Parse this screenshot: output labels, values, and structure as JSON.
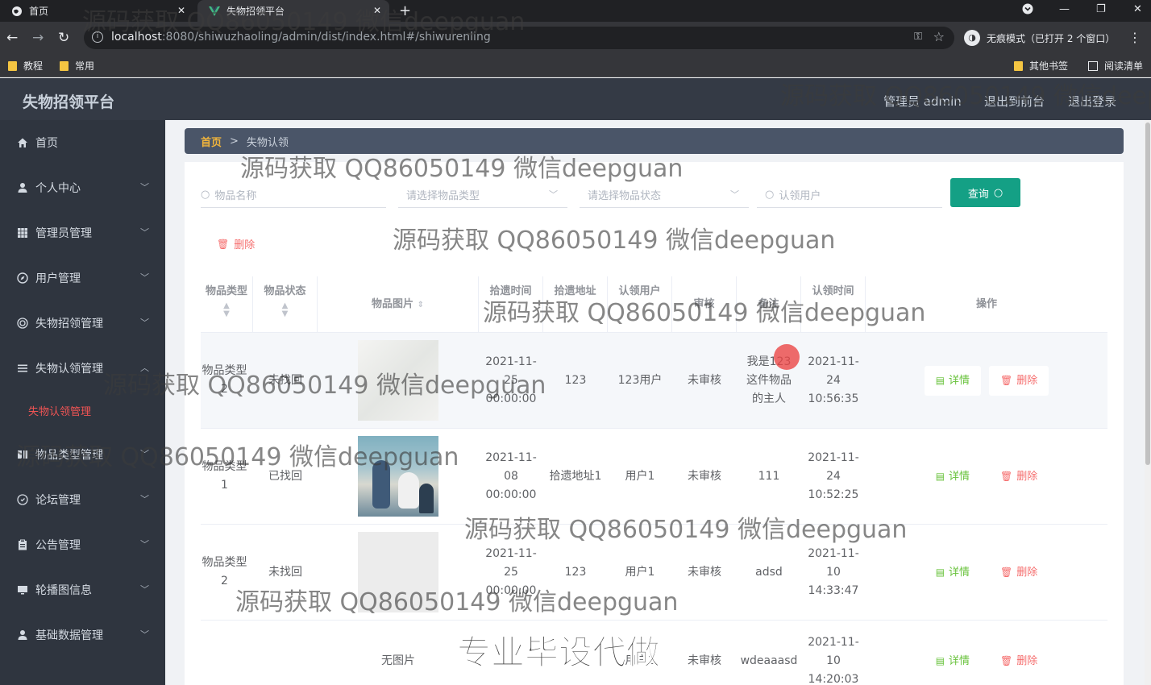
{
  "browser": {
    "tabs": [
      {
        "title": "首页",
        "icon": "globe-icon"
      },
      {
        "title": "失物招领平台",
        "icon": "vue-icon"
      }
    ],
    "url_host": "localhost",
    "url_path": ":8080/shiwuzhaoling/admin/dist/index.html#/shiwurenling",
    "incognito_label": "无痕模式（已打开 2 个窗口）",
    "bookmarks": [
      "教程",
      "常用"
    ],
    "bookmarks_right": [
      "其他书签",
      "阅读清单"
    ]
  },
  "header": {
    "title": "失物招领平台",
    "user_label": "管理员 admin",
    "to_front_label": "退出到前台",
    "logout_label": "退出登录"
  },
  "sidebar": {
    "items": [
      {
        "label": "首页",
        "icon": "home-icon"
      },
      {
        "label": "个人中心",
        "icon": "user-icon"
      },
      {
        "label": "管理员管理",
        "icon": "grid-icon"
      },
      {
        "label": "用户管理",
        "icon": "compass-icon"
      },
      {
        "label": "失物招领管理",
        "icon": "target-icon"
      },
      {
        "label": "失物认领管理",
        "icon": "list-icon"
      },
      {
        "label": "物品类型管理",
        "icon": "layers-icon"
      },
      {
        "label": "论坛管理",
        "icon": "chat-icon"
      },
      {
        "label": "公告管理",
        "icon": "clipboard-icon"
      },
      {
        "label": "轮播图信息",
        "icon": "monitor-icon"
      },
      {
        "label": "基础数据管理",
        "icon": "person-icon"
      }
    ],
    "active_sub": "失物认领管理"
  },
  "breadcrumb": {
    "home": "首页",
    "separator": ">",
    "current": "失物认领"
  },
  "search": {
    "item_name_placeholder": "物品名称",
    "item_type_placeholder": "请选择物品类型",
    "item_status_placeholder": "请选择物品状态",
    "claim_user_placeholder": "认领用户",
    "query_label": "查询"
  },
  "batch_delete_label": "删除",
  "table": {
    "headers": [
      "物品类型",
      "物品状态",
      "物品图片",
      "拾遗时间",
      "拾遗地址",
      "认领用户",
      "审核",
      "备注",
      "认领时间",
      "操作"
    ],
    "rows": [
      {
        "type": "物品类型2",
        "status": "未找回",
        "image": "light",
        "time": "2021-11-25 00:00:00",
        "address": "123",
        "user": "123用户",
        "review": "未审核",
        "remark": "我是123这件物品的主人",
        "claim_time": "2021-11-24 10:56:35"
      },
      {
        "type": "物品类型1",
        "status": "已找回",
        "image": "vases",
        "time": "2021-11-08 00:00:00",
        "address": "拾遗地址1",
        "user": "用户1",
        "review": "未审核",
        "remark": "111",
        "claim_time": "2021-11-24 10:52:25"
      },
      {
        "type": "物品类型2",
        "status": "未找回",
        "image": "blank",
        "time": "2021-11-25 00:00:00",
        "address": "123",
        "user": "用户1",
        "review": "未审核",
        "remark": "adsd",
        "claim_time": "2021-11-10 14:33:47"
      },
      {
        "type": "",
        "status": "",
        "image": "none",
        "no_image_label": "无图片",
        "time": "",
        "address": "",
        "user": "用户1",
        "review": "未审核",
        "remark": "wdeaaasd",
        "claim_time": "2021-11-10 14:20:03"
      }
    ],
    "detail_label": "详情",
    "delete_label": "删除"
  },
  "watermarks": {
    "text": "源码获取 QQ86050149 微信deepguan",
    "text_cut": "源码获取 QQ86050149 微信deep",
    "big": "专业毕设代做"
  },
  "colors": {
    "accent": "#14a085",
    "danger": "#f56c6c",
    "success": "#67c23a",
    "sidebar": "#2f353f",
    "header": "#343a45"
  }
}
